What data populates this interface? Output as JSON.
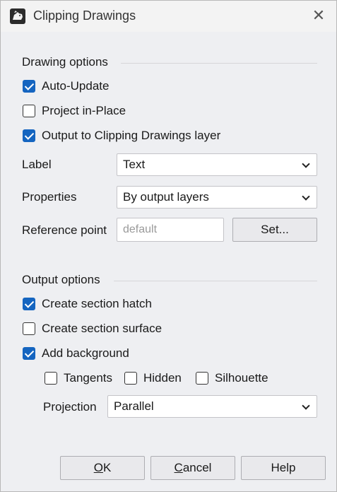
{
  "window": {
    "title": "Clipping Drawings",
    "close_glyph": "✕"
  },
  "drawing_options": {
    "title": "Drawing options",
    "auto_update": {
      "label": "Auto-Update",
      "checked": true
    },
    "project_in_place": {
      "label": "Project in-Place",
      "checked": false
    },
    "output_to_layer": {
      "label": "Output to Clipping Drawings layer",
      "checked": true
    },
    "label_field": {
      "label": "Label",
      "value": "Text"
    },
    "properties_field": {
      "label": "Properties",
      "value": "By output layers"
    },
    "reference_point": {
      "label": "Reference point",
      "placeholder": "default",
      "set_button": "Set..."
    }
  },
  "output_options": {
    "title": "Output options",
    "create_section_hatch": {
      "label": "Create section hatch",
      "checked": true
    },
    "create_section_surface": {
      "label": "Create section surface",
      "checked": false
    },
    "add_background": {
      "label": "Add background",
      "checked": true
    },
    "tangents": {
      "label": "Tangents",
      "checked": false
    },
    "hidden": {
      "label": "Hidden",
      "checked": false
    },
    "silhouette": {
      "label": "Silhouette",
      "checked": false
    },
    "projection": {
      "label": "Projection",
      "value": "Parallel"
    }
  },
  "buttons": {
    "ok": {
      "mnemonic": "O",
      "rest": "K"
    },
    "cancel": {
      "mnemonic": "C",
      "rest": "ancel"
    },
    "help": {
      "label": "Help"
    }
  },
  "colors": {
    "accent": "#1565c0",
    "background": "#eeeff2"
  },
  "icons": [
    "rhino-app-icon",
    "close-icon",
    "checkbox-checked-icon",
    "checkbox-unchecked-icon",
    "chevron-down-icon"
  ]
}
